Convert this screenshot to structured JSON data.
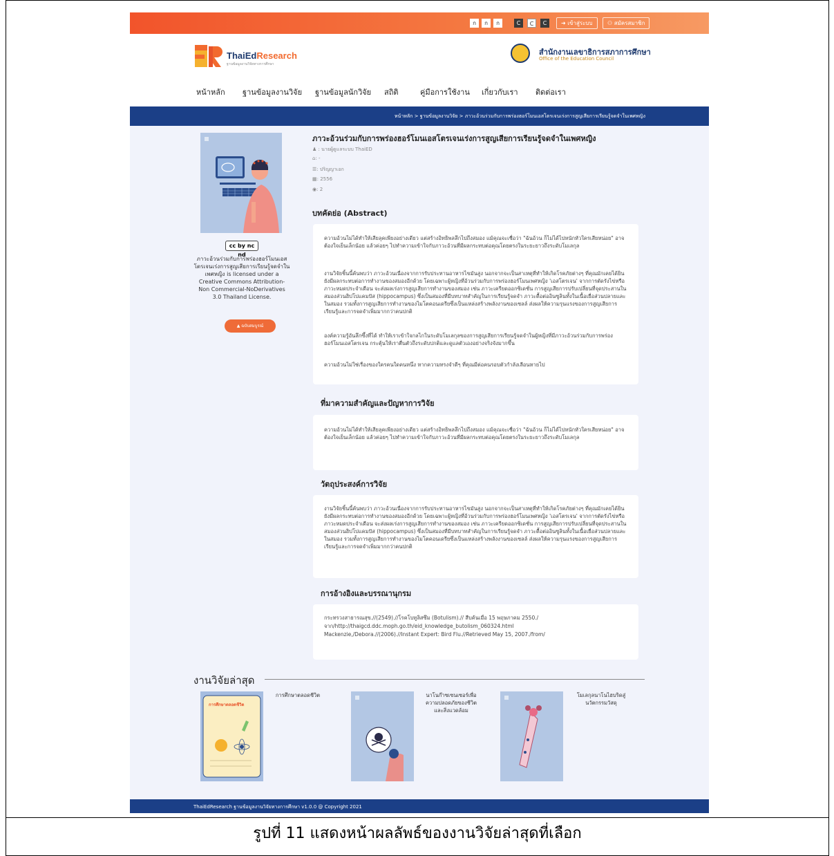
{
  "topbar": {
    "font_size_buttons": [
      "ก",
      "ก",
      "ก"
    ],
    "contrast_buttons": [
      "C",
      "C",
      "C"
    ],
    "login_label": "เข้าสู่ระบบ",
    "register_label": "สมัครสมาชิก"
  },
  "header": {
    "logo_text_a": "ThaiEd",
    "logo_text_b": "Research",
    "logo_subtitle": "ฐานข้อมูลงานวิจัยทางการศึกษา",
    "org_name_th": "สำนักงานเลขาธิการสภาการศึกษา",
    "org_name_en": "Office of the Education Council"
  },
  "nav": {
    "items": [
      "หน้าหลัก",
      "ฐานข้อมูลงานวิจัย",
      "ฐานข้อมูลนักวิจัย",
      "สถิติ",
      "คู่มือการใช้งาน",
      "เกี่ยวกับเรา",
      "ติดต่อเรา"
    ]
  },
  "breadcrumb": "หน้าหลัก > ฐานข้อมูลงานวิจัย > ภาวะอ้วนร่วมกับการพร่องฮอร์โมนเอสโตรเจนเร่งการสูญเสียการเรียนรู้จดจำในเพศหญิง",
  "research": {
    "title": "ภาวะอ้วนร่วมกับการพร่องฮอร์โมนเอสโตรเจนเร่งการสูญเสียการเรียนรู้จดจำในเพศหญิง",
    "author": ": นายผู้ดูแลระบบ ThaiED",
    "institution": ": -",
    "degree": ": ปริญญาเอก",
    "year": ": 2556",
    "views": ": 2",
    "cc_badge": "cc by nc nd",
    "license": "ภาวะอ้วนร่วมกับการพร่องฮอร์โมนเอสโตรเจนเร่งการสูญเสียการเรียนรู้จดจำในเพศหญิง is licensed under a Creative Commons Attribution-Non Commercial-NoDerivatives 3.0 Thailand License.",
    "fulltext_label": "ฉบับสมบูรณ์"
  },
  "sections": {
    "abstract_heading": "บทคัดย่อ (Abstract)",
    "abstract_p1": "ความอ้วนไม่ได้ทำให้เสียลุคเพียงอย่างเดียว แต่สร้างอิทธิพลลึกไปถึงสมอง แม้คุณจะเชื่อว่า \"ฉันอ้วน ก็ไม่ได้ไปหนักหัวใครเสียหน่อย\" อาจต้องใจเย็นเล็กน้อย แล้วค่อยๆ ไปทำความเข้าใจกับภาวะอ้วนที่มีผลกระทบต่อคุณโดยตรงในระยะยาวถึงระดับโมเลกุล",
    "abstract_p2": "งานวิจัยชิ้นนี้ค้นพบว่า ภาวะอ้วนเนื่องจากการรับประทานอาหารไขมันสูง นอกจากจะเป็นสาเหตุที่ทำให้เกิดโรคภัยต่างๆ ที่คุณมักเคยได้ยิน ยังมีผลกระทบต่อการทำงานของสมองอีกด้วย โดยเฉพาะผู้หญิงที่อ้วนร่วมกับการพร่องฮอร์โมนเพศหญิง 'เอสโตรเจน' จากการตัดรังไข่หรือภาวะหมดประจำเดือน จะส่งผลเร่งการสูญเสียการทำงานของสมอง เช่น ภาวะเครียดออกซิเดชั่น การสูญเสียการปรับเปลี่ยนที่จุดประสานในสมองส่วนฮิปโปแคมปัส (hippocampus) ซึ่งเป็นสมองที่มีบทบาทสำคัญในการเรียนรู้จดจำ ภาวะดื้อต่ออินซูลินทั้งในเนื้อเยื่อส่วนปลายและในสมอง รวมทั้งการสูญเสียการทำงานของไมโตคอนเดรียซึ่งเป็นแหล่งสร้างพลังงานของเซลล์ ส่งผลให้ความรุนแรงของการสูญเสียการเรียนรู้และการจดจำเพิ่มมากกว่าคนปกติ",
    "abstract_p3": "องค์ความรู้อันลึกซึ้งที่ได้ ทำให้เราเข้าใจกลไกในระดับโมเลกุลของการสูญเสียการเรียนรู้จดจำในผู้หญิงที่มีภาวะอ้วนร่วมกับการพร่องฮอร์โมนเอสโตรเจน กระตุ้นให้เราตื่นตัวถึงระดับปกติและดูแลตัวเองอย่างจริงจังมากขึ้น",
    "abstract_p4": "ความอ้วนไม่ใช่เรื่องของใครคนใดคนหนึ่ง หากความทรงจำดีๆ ที่คุณมีต่อคนรอบตัวกำลังเลือนหายไป",
    "background_heading": "ที่มาความสำคัญและปัญหาการวิจัย",
    "background_p1": "ความอ้วนไม่ได้ทำให้เสียลุคเพียงอย่างเดียว แต่สร้างอิทธิพลลึกไปถึงสมอง แม้คุณจะเชื่อว่า \"ฉันอ้วน ก็ไม่ได้ไปหนักหัวใครเสียหน่อย\" อาจต้องใจเย็นเล็กน้อย แล้วค่อยๆ ไปทำความเข้าใจกับภาวะอ้วนที่มีผลกระทบต่อคุณโดยตรงในระยะยาวถึงระดับโมเลกุล",
    "objective_heading": "วัตถุประสงค์การวิจัย",
    "objective_p1": "งานวิจัยชิ้นนี้ค้นพบว่า ภาวะอ้วนเนื่องจากการรับประทานอาหารไขมันสูง นอกจากจะเป็นสาเหตุที่ทำให้เกิดโรคภัยต่างๆ ที่คุณมักเคยได้ยิน ยังมีผลกระทบต่อการทำงานของสมองอีกด้วย โดยเฉพาะผู้หญิงที่อ้วนร่วมกับการพร่องฮอร์โมนเพศหญิง 'เอสโตรเจน' จากการตัดรังไข่หรือภาวะหมดประจำเดือน จะส่งผลเร่งการสูญเสียการทำงานของสมอง เช่น ภาวะเครียดออกซิเดชั่น การสูญเสียการปรับเปลี่ยนที่จุดประสานในสมองส่วนฮิปโปแคมปัส (hippocampus) ซึ่งเป็นสมองที่มีบทบาทสำคัญในการเรียนรู้จดจำ ภาวะดื้อต่ออินซูลินทั้งในเนื้อเยื่อส่วนปลายและในสมอง รวมทั้งการสูญเสียการทำงานของไมโตคอนเดรียซึ่งเป็นแหล่งสร้างพลังงานของเซลล์ ส่งผลให้ความรุนแรงของการสูญเสียการเรียนรู้และการจดจำเพิ่มมากกว่าคนปกติ",
    "references_heading": "การอ้างอิงและบรรณานุกรม",
    "references_l1": "กระทรวงสาธารณสุข.//(2549).//โรคโบทูลิสซึม (Botulism).// สืบค้นเมื่อ 15 พฤษภาคม 2550./",
    "references_l2": "จาก/http://thaigcd.ddc.moph.go.th/eid_knowledge_butolism_060324.html",
    "references_l3": "Mackenzie,/Debora.//(2006).//Instant Expert: Bird Flu.//Retrieved May 15, 2007./from/"
  },
  "latest": {
    "heading": "งานวิจัยล่าสุด",
    "book_cover_label": "การศึกษาตลอดชีวิต",
    "items": [
      "การศึกษาตลอดชีวิต",
      "นาโนก๊าซเซนเซอร์เพื่อความปลอดภัยของชีวิตและสิ่งแวดล้อม",
      "โมเลกุลนาโนไฮบริดสู่นวัตกรรมวัสดุ"
    ]
  },
  "footer": "ThaiEdResearch ฐานข้อมูลงานวิจัยทางการศึกษา v1.0.0 @ Copyright 2021",
  "caption": "รูปที่ 11 แสดงหน้าผลลัพธ์ของงานวิจัยล่าสุดที่เลือก",
  "colors": {
    "accent": "#f2542b",
    "navy": "#1b3f87",
    "page_bg": "#f1f3fb"
  }
}
